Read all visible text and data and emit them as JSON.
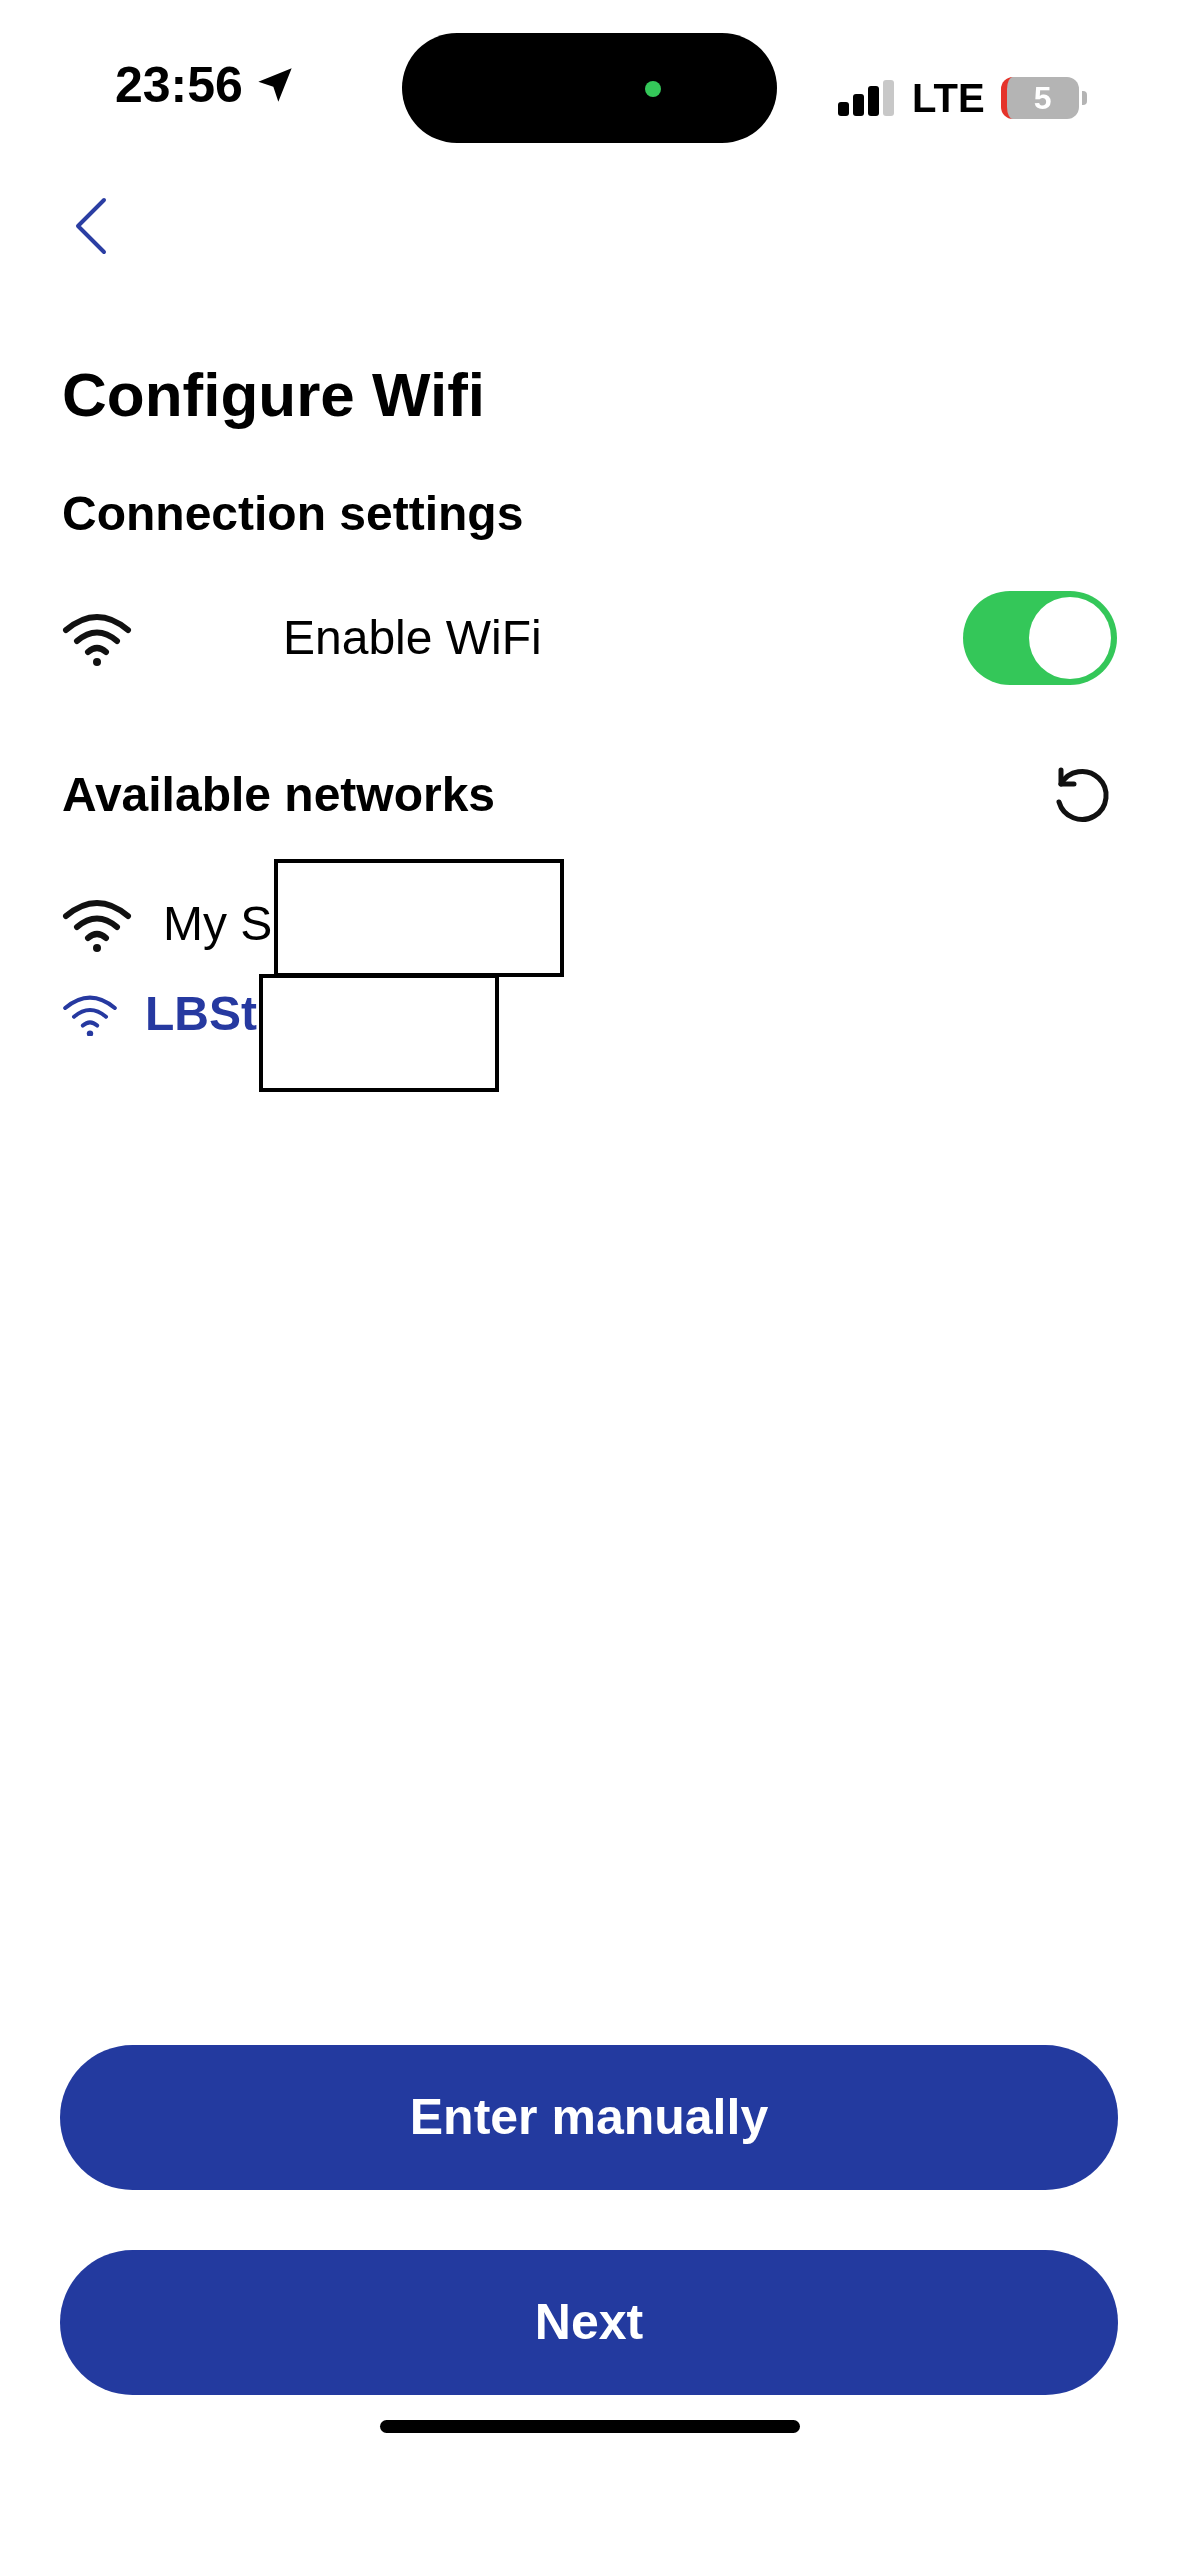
{
  "status_bar": {
    "time": "23:56",
    "network": "LTE",
    "battery": "5"
  },
  "title": "Configure Wifi",
  "connection_settings": {
    "heading": "Connection settings",
    "enable_wifi": {
      "label": "Enable WiFi",
      "on": true
    }
  },
  "available_networks": {
    "heading": "Available networks",
    "networks": [
      {
        "name": "My S",
        "selected": false
      },
      {
        "name": "LBSt",
        "selected": true
      }
    ]
  },
  "buttons": [
    "Enter manually",
    "Next"
  ]
}
